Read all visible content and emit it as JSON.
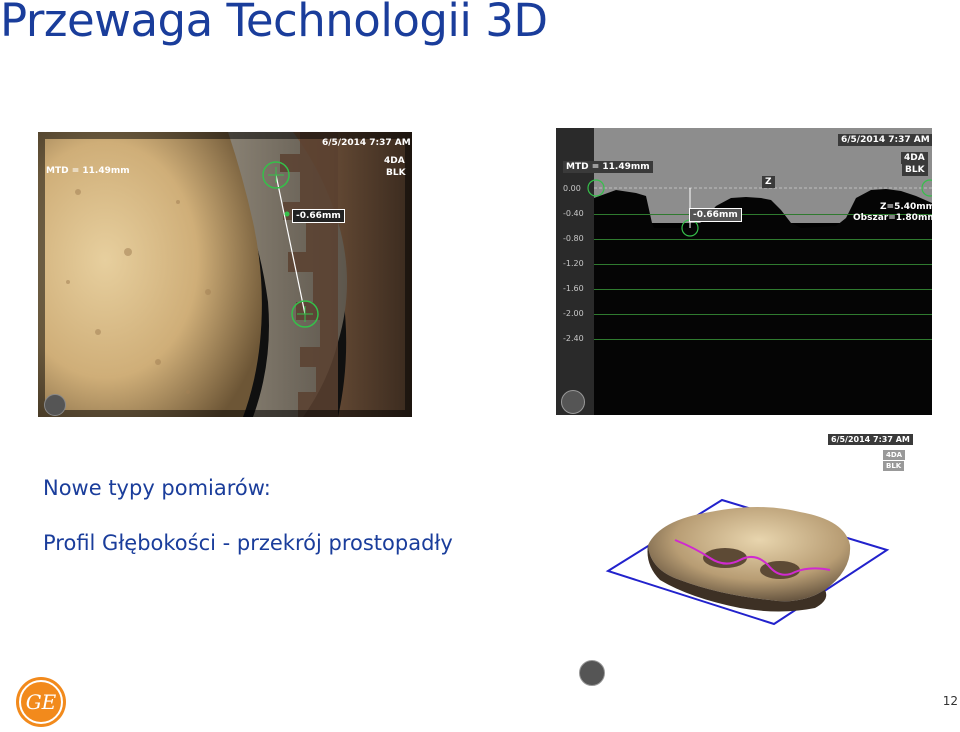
{
  "slide": {
    "title": "Przewaga Technologii 3D",
    "bullet_heading": "Nowe typy pomiarów:",
    "bullet_item": "Profil Głębokości - przekrój prostopadły",
    "page_number": "12"
  },
  "image_left": {
    "mtd": "MTD = 11.49mm",
    "datetime": "6/5/2014  7:37 AM",
    "tip_line1": "4DA",
    "tip_line2": "BLK",
    "depth_label": "-0.66mm"
  },
  "image_profile": {
    "mtd": "MTD = 11.49mm",
    "datetime": "6/5/2014  7:37 AM",
    "tip_line1": "4DA",
    "tip_line2": "BLK",
    "z_marker": "Z",
    "depth_label": "-0.66mm",
    "z_value": "Z=5.40mm",
    "area": "Obszar=1.80mm²",
    "y_ticks": [
      "0.00",
      "-0.40",
      "-0.80",
      "-1.20",
      "-1.60",
      "-2.00",
      "-2.40"
    ]
  },
  "image_3d": {
    "datetime": "6/5/2014  7:37 AM",
    "tip_line1": "4DA",
    "tip_line2": "BLK"
  },
  "colors": {
    "brand_blue": "#1a3d9b",
    "grid_green": "#2f7a2f",
    "cursor_green": "#35c04a",
    "plane_blue": "#2222cc",
    "profile_magenta": "#d02ad0"
  }
}
